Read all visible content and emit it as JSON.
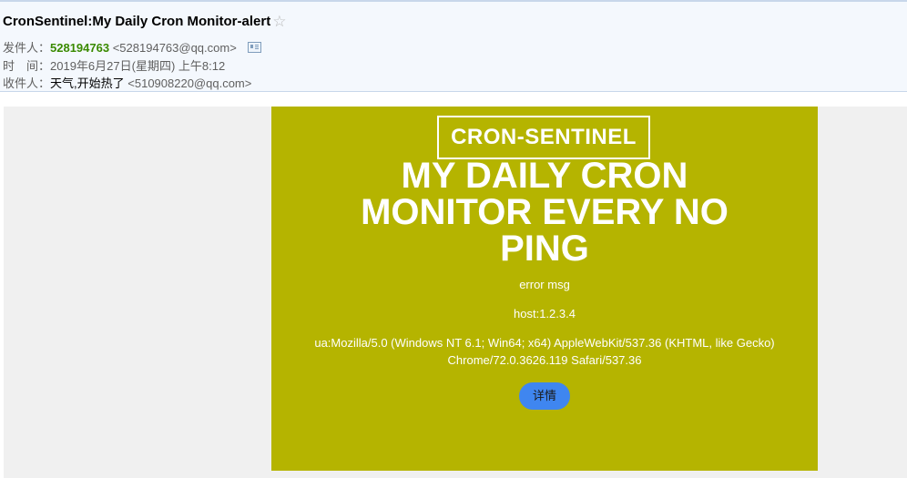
{
  "header": {
    "subject": "CronSentinel:My Daily Cron Monitor-alert",
    "from_label": "发件人：",
    "from_name": "528194763",
    "from_email": "<528194763@qq.com>",
    "time_label": "时　间：",
    "time_value": "2019年6月27日(星期四) 上午8:12",
    "to_label": "收件人：",
    "to_name": "天气,开始热了",
    "to_email": "<510908220@qq.com>",
    "star_icon": "☆"
  },
  "email": {
    "brand": "CRON-SENTINEL",
    "title": "MY DAILY CRON MONITOR EVERY NO PING",
    "error": "error msg",
    "host": "host:1.2.3.4",
    "ua": "ua:Mozilla/5.0 (Windows NT 6.1; Win64; x64) AppleWebKit/537.36 (KHTML, like Gecko) Chrome/72.0.3626.119 Safari/537.36",
    "details_button": "详情"
  },
  "colors": {
    "card_background": "#b5b400",
    "button": "#3f86f0",
    "sender_name": "#3a8a00"
  }
}
